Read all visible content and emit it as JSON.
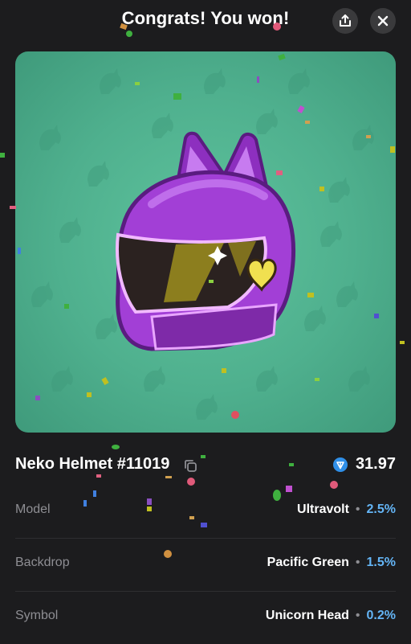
{
  "header": {
    "title": "Congrats! You won!",
    "share_icon": "share-icon",
    "close_icon": "close-icon"
  },
  "gift": {
    "name": "Neko Helmet #11019",
    "copy_icon": "copy-icon",
    "price_icon": "ton-icon",
    "price": "31.97"
  },
  "attributes": [
    {
      "label": "Model",
      "value": "Ultravolt",
      "rarity": "2.5%"
    },
    {
      "label": "Backdrop",
      "value": "Pacific Green",
      "rarity": "1.5%"
    },
    {
      "label": "Symbol",
      "value": "Unicorn Head",
      "rarity": "0.2%"
    }
  ],
  "separator": "•",
  "colors": {
    "background": "#1c1c1e",
    "backdrop": "#4fb08e",
    "helmet": "#a23fd6",
    "accent_blue": "#64b5f6",
    "label_gray": "#8e8e93"
  }
}
